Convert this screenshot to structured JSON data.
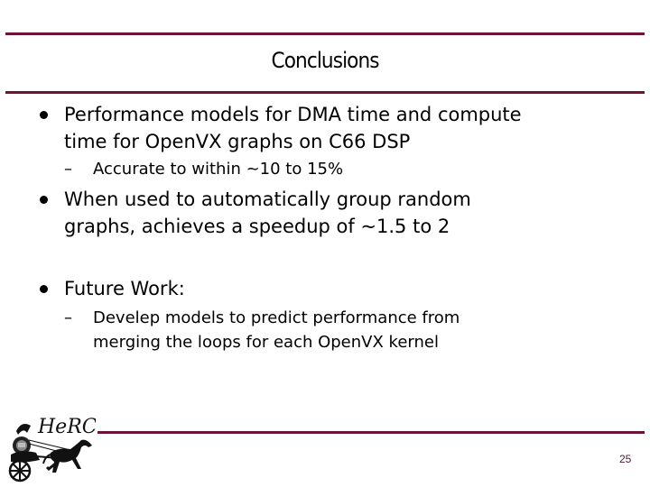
{
  "slide": {
    "title": "Conclusions",
    "accent_color": "#6e1238",
    "bullets": [
      {
        "text": "Performance models for DMA time and compute time for OpenVX graphs on C66 DSP",
        "lines": [
          "Performance models for DMA time and compute",
          "time for OpenVX graphs on C66 DSP"
        ],
        "sub": [
          {
            "dash": "–",
            "text": "Accurate to within ~10 to 15%"
          }
        ]
      },
      {
        "text": "When used to automatically group random graphs, achieves a speedup of ~1.5 to 2",
        "lines": [
          "When used to automatically group random",
          "graphs, achieves a speedup of ~1.5 to 2"
        ]
      },
      {
        "text": "Future Work:",
        "lines": [
          "Future Work:"
        ],
        "sub": [
          {
            "dash": "–",
            "text": "Develep models to predict performance from merging the loops for each OpenVX kernel",
            "lines": [
              "Develep models to predict performance from",
              "merging the loops for each OpenVX kernel"
            ]
          }
        ]
      }
    ],
    "footer": {
      "logo_text": "HeRC",
      "logo_icon": "chariot-horse-logo",
      "page_number": "25"
    }
  }
}
